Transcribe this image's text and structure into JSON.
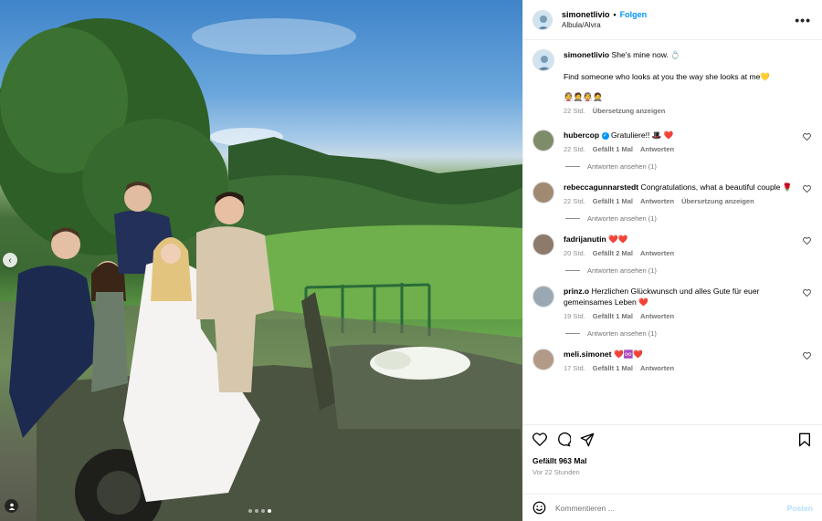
{
  "post": {
    "author": "simonetlivio",
    "separator": "•",
    "follow_label": "Folgen",
    "location": "Albula/Alvra",
    "more_label": "•••"
  },
  "caption": {
    "user": "simonetlivio",
    "line1": "She's mine now. 💍",
    "line2": "Find someone who looks at you the way she looks at me💛",
    "line3": "👰🤵👰🤵",
    "time": "22 Std.",
    "translate": "Übersetzung anzeigen"
  },
  "comments": [
    {
      "user": "hubercop",
      "verified": true,
      "text": "Gratuliere!! 🎩 ❤️",
      "time": "22 Std.",
      "likes": "Gefällt 1 Mal",
      "reply": "Antworten",
      "translate": "",
      "replies": "Antworten ansehen (1)"
    },
    {
      "user": "rebeccagunnarstedt",
      "verified": false,
      "text": "Congratulations, what a beautiful couple 🌹",
      "time": "22 Std.",
      "likes": "Gefällt 1 Mal",
      "reply": "Antworten",
      "translate": "Übersetzung anzeigen",
      "replies": "Antworten ansehen (1)"
    },
    {
      "user": "fadrijanutin",
      "verified": false,
      "text": "❤️❤️",
      "time": "20 Std.",
      "likes": "Gefällt 2 Mal",
      "reply": "Antworten",
      "translate": "",
      "replies": "Antworten ansehen (1)"
    },
    {
      "user": "prinz.o",
      "verified": false,
      "text": "Herzlichen Glückwunsch und alles Gute für euer gemeinsames Leben ❤️",
      "time": "19 Std.",
      "likes": "Gefällt 1 Mal",
      "reply": "Antworten",
      "translate": "",
      "replies": "Antworten ansehen (1)"
    },
    {
      "user": "meli.simonet",
      "verified": false,
      "text": "❤️♾️❤️",
      "time": "17 Std.",
      "likes": "Gefällt 1 Mal",
      "reply": "Antworten",
      "translate": "",
      "replies": ""
    }
  ],
  "stats": {
    "likes": "Gefällt 963 Mal",
    "date": "Vor 22 Stunden"
  },
  "composer": {
    "placeholder": "Kommentieren ...",
    "post_label": "Posten"
  },
  "colors": {
    "link_blue": "#0095f6",
    "post_disabled": "#b2dffc",
    "meta_gray": "#8e8e8e"
  },
  "carousel": {
    "dots": 4,
    "active": 3
  }
}
